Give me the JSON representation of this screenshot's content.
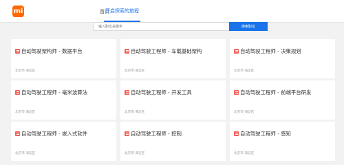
{
  "header": {
    "logo_text": "mi",
    "nav": [
      {
        "label": "首页",
        "active": false
      },
      {
        "label": "开启探索的旅程",
        "active": true
      }
    ]
  },
  "search": {
    "placeholder": "输入职位关键字",
    "button_label": "搜索职位"
  },
  "jobs": [
    {
      "title": "自动驾驶架构师 - 数据平台",
      "location": "北京市-海淀区"
    },
    {
      "title": "自动驾驶工程师 - 车载基础架构",
      "location": "北京市-海淀区"
    },
    {
      "title": "自动驾驶工程师 - 决策规划",
      "location": "北京市-海淀区"
    },
    {
      "title": "自动驾驶工程师 - 毫米波算法",
      "location": "北京市-海淀区"
    },
    {
      "title": "自动驾驶工程师 - 开发工具",
      "location": "北京市-海淀区"
    },
    {
      "title": "自动驾驶工程师 - 前端平台研发",
      "location": "北京市-海淀区"
    },
    {
      "title": "自动驾驶工程师 - 嵌入式软件",
      "location": "北京市-海淀区"
    },
    {
      "title": "自动驾驶工程师 - 控制",
      "location": "北京市-海淀区"
    },
    {
      "title": "自动驾驶工程师 - 感知",
      "location": "北京市-海淀区"
    }
  ],
  "colors": {
    "brand": "#ff6700",
    "accent": "#1a73e8",
    "job_icon": "#f2635b",
    "background": "#f2f2f2"
  },
  "icons": {
    "logo": "mi-logo-icon",
    "job": "job-document-icon"
  }
}
